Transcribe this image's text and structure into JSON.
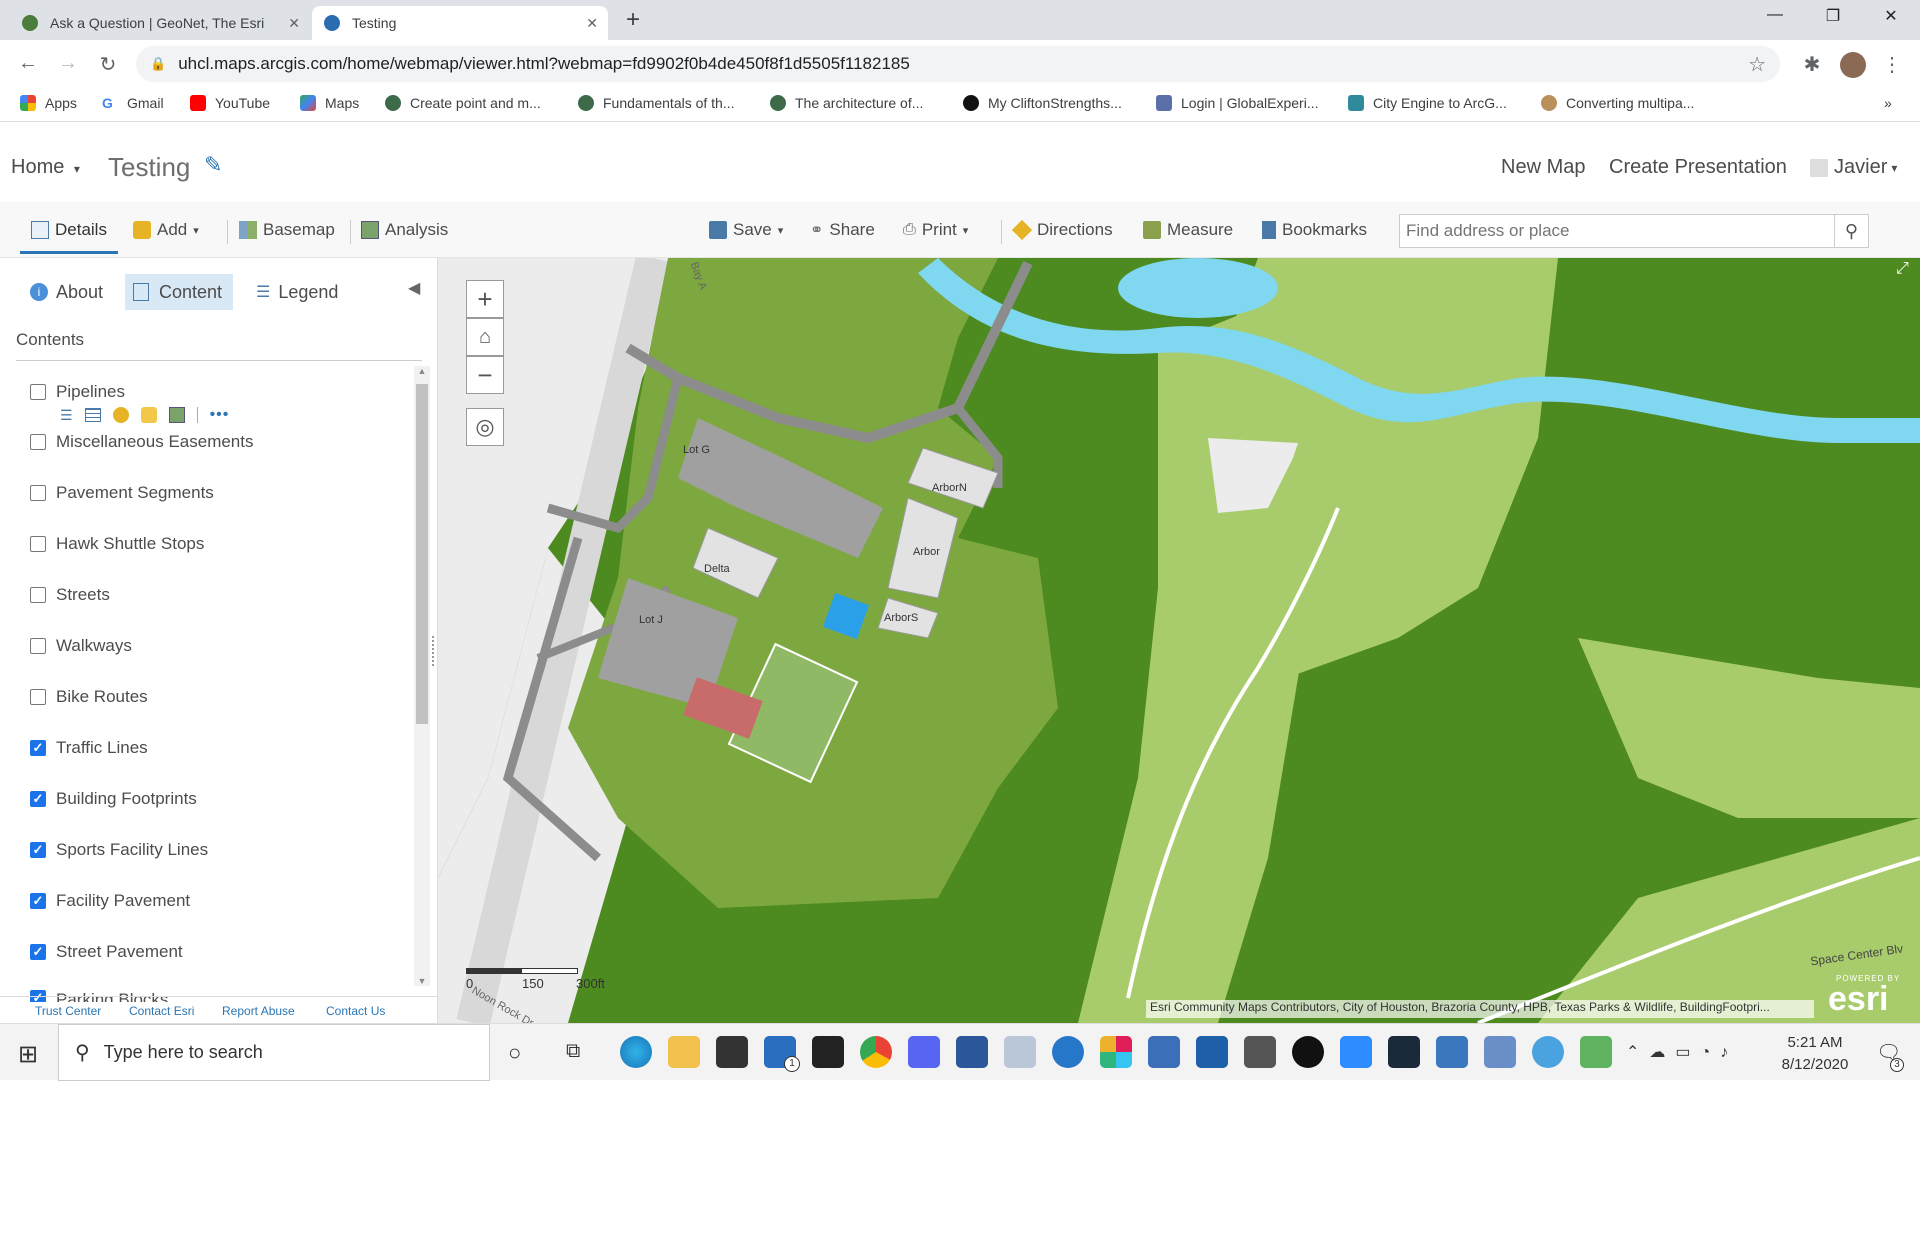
{
  "browser": {
    "tabs": [
      {
        "title": "Ask a Question | GeoNet, The Esri"
      },
      {
        "title": "Testing"
      }
    ],
    "new_tab": "+",
    "url": "uhcl.maps.arcgis.com/home/webmap/viewer.html?webmap=fd9902f0b4de450f8f1d5505f1182185",
    "bookmarks": [
      "Apps",
      "Gmail",
      "YouTube",
      "Maps",
      "Create point and m...",
      "Fundamentals of th...",
      "The architecture of...",
      "My CliftonStrengths...",
      "Login | GlobalExperi...",
      "City Engine to ArcG...",
      "Converting multipa..."
    ],
    "bookmarks_overflow": "»"
  },
  "header": {
    "home": "Home",
    "title": "Testing",
    "new_map": "New Map",
    "create_presentation": "Create Presentation",
    "user": "Javier"
  },
  "toolbar": {
    "details": "Details",
    "add": "Add",
    "basemap": "Basemap",
    "analysis": "Analysis",
    "save": "Save",
    "share": "Share",
    "print": "Print",
    "directions": "Directions",
    "measure": "Measure",
    "bookmarks": "Bookmarks",
    "search_placeholder": "Find address or place"
  },
  "panel": {
    "tabs": {
      "about": "About",
      "content": "Content",
      "legend": "Legend"
    },
    "contents_heading": "Contents",
    "layers": [
      {
        "name": "Pipelines",
        "checked": false
      },
      {
        "name": "Miscellaneous Easements",
        "checked": false
      },
      {
        "name": "Pavement Segments",
        "checked": false
      },
      {
        "name": "Hawk Shuttle Stops",
        "checked": false
      },
      {
        "name": "Streets",
        "checked": false
      },
      {
        "name": "Walkways",
        "checked": false
      },
      {
        "name": "Bike Routes",
        "checked": false
      },
      {
        "name": "Traffic Lines",
        "checked": true
      },
      {
        "name": "Building Footprints",
        "checked": true
      },
      {
        "name": "Sports Facility Lines",
        "checked": true
      },
      {
        "name": "Facility Pavement",
        "checked": true
      },
      {
        "name": "Street Pavement",
        "checked": true
      },
      {
        "name": "Parking Blocks",
        "checked": true
      }
    ],
    "footer": [
      "Trust Center",
      "Contact Esri",
      "Report Abuse",
      "Contact Us"
    ]
  },
  "map": {
    "labels": {
      "lot_g": "Lot G",
      "delta": "Delta",
      "arbor_n": "ArborN",
      "arbor": "Arbor",
      "arbor_s": "ArborS",
      "lot_j": "Lot J",
      "space_center": "Space Center Blv",
      "bay": "Bay A",
      "noon_rock": "Noon Rock Dr"
    },
    "scale": {
      "zero": "0",
      "mid": "150",
      "end": "300ft"
    },
    "attribution": "Esri Community Maps Contributors, City of Houston, Brazoria County, HPB, Texas Parks & Wildlife, BuildingFootpri...",
    "logo_small": "POWERED BY",
    "logo": "esri",
    "colors": {
      "forest": "#4d8a1f",
      "lawn": "#7da83f",
      "meadow": "#a8cc6b",
      "water": "#7fd7f0",
      "road": "#8c8c8c",
      "urban": "#ececec"
    }
  },
  "taskbar": {
    "search_placeholder": "Type here to search",
    "time": "5:21 AM",
    "date": "8/12/2020",
    "notification_count": "3",
    "mail_badge": "1"
  }
}
